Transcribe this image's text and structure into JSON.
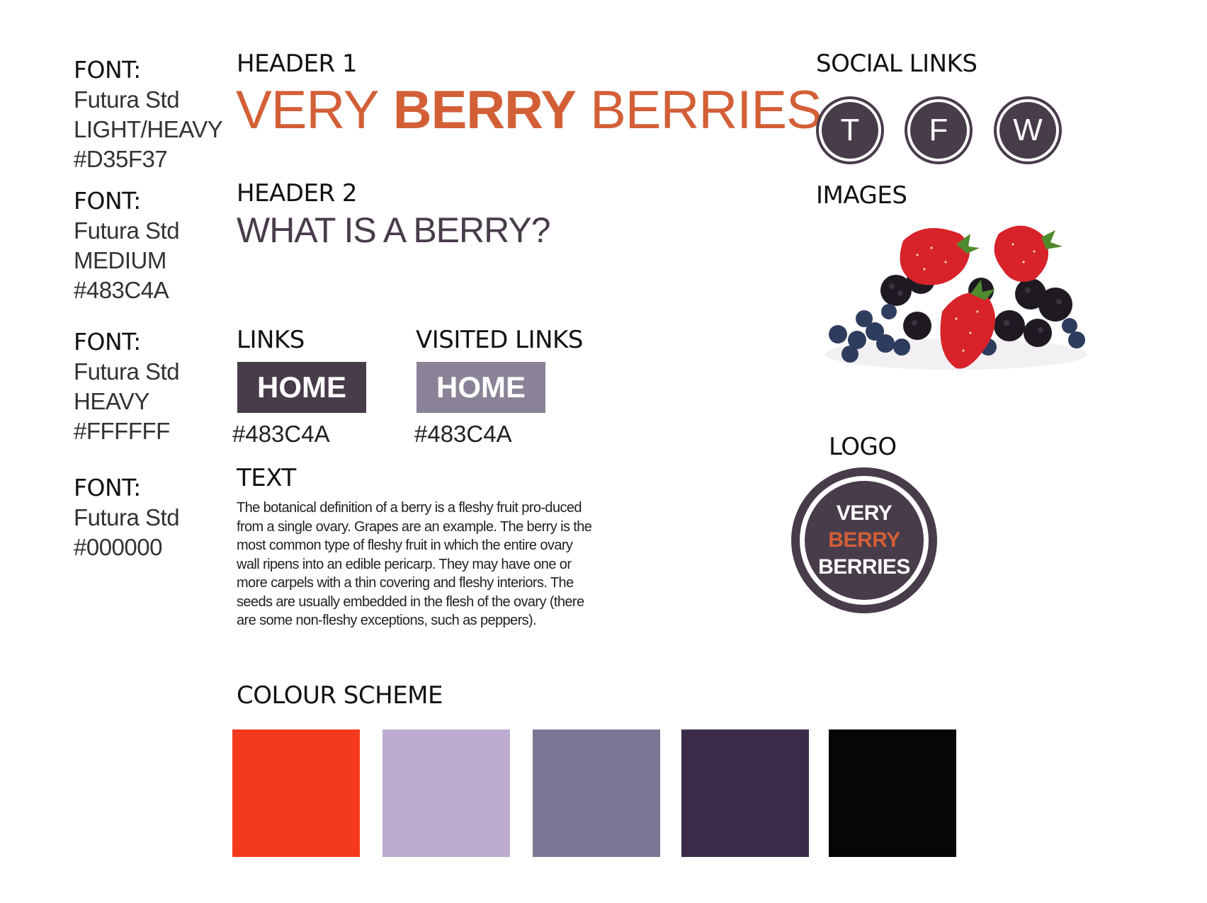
{
  "colors": {
    "accent": "#D35F37",
    "primary": "#483C4A",
    "visited": "#8A8296",
    "text": "#000000"
  },
  "specs": [
    {
      "title": "FONT:",
      "lines": [
        "Futura Std",
        "LIGHT/HEAVY",
        "#D35F37"
      ]
    },
    {
      "title": "FONT:",
      "lines": [
        "Futura Std",
        "MEDIUM",
        "#483C4A"
      ]
    },
    {
      "title": "FONT:",
      "lines": [
        "Futura Std",
        "HEAVY",
        "#FFFFFF"
      ]
    },
    {
      "title": "FONT:",
      "lines": [
        "Futura Std",
        "#000000"
      ]
    }
  ],
  "header1": {
    "label": "HEADER 1",
    "word1": "VERY",
    "word2": "BERRY",
    "word3": "BERRIES"
  },
  "header2": {
    "label": "HEADER 2",
    "text": "WHAT IS A BERRY?"
  },
  "links": {
    "label": "LINKS",
    "button": "HOME",
    "hex": "#483C4A"
  },
  "visited_links": {
    "label": "VISITED LINKS",
    "button": "HOME",
    "hex": "#483C4A"
  },
  "text_section": {
    "label": "TEXT",
    "body": "The botanical definition of a berry is a fleshy fruit pro-duced from a single ovary. Grapes are an example. The berry is the most common type of fleshy fruit in which the entire ovary wall ripens into an edible pericarp. They may have one or more carpels with a thin covering and fleshy interiors. The seeds are usually embedded in the flesh of the ovary (there are some non-fleshy exceptions, such as peppers)."
  },
  "colour_scheme": {
    "label": "COLOUR SCHEME",
    "swatches": [
      "#F43A1E",
      "#BCABCF",
      "#797793",
      "#3A2B4A",
      "#060606"
    ]
  },
  "social": {
    "label": "SOCIAL LINKS",
    "items": [
      {
        "letter": "T",
        "icon": "twitter-icon"
      },
      {
        "letter": "F",
        "icon": "facebook-icon"
      },
      {
        "letter": "W",
        "icon": "web-icon"
      }
    ]
  },
  "images": {
    "label": "IMAGES"
  },
  "logo": {
    "label": "LOGO",
    "line1": "VERY",
    "line2": "BERRY",
    "line3": "BERRIES"
  }
}
